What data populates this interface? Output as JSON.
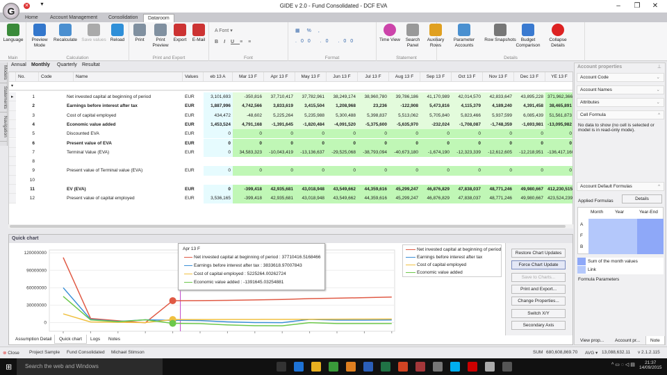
{
  "app": {
    "title": "GIDE v 2.0 - Fund Consolidated - DCF EVA",
    "logo_letter": "G"
  },
  "ribbon_tabs": [
    "Home",
    "Account Management",
    "Consolidation",
    "Dataroom"
  ],
  "ribbon": {
    "groups": [
      "Main",
      "Calculation",
      "Print and Export",
      "Font",
      "Format",
      "Statement",
      "Details"
    ],
    "buttons": [
      {
        "label": "Language",
        "color": "#3a8a3a"
      },
      {
        "label": "Preview Mode",
        "color": "#3377cc"
      },
      {
        "label": "Recalculate",
        "color": "#4a8fd0"
      },
      {
        "label": "Save values",
        "color": "#aaaaaa"
      },
      {
        "label": "Reload",
        "color": "#2f8fd8"
      },
      {
        "label": "Print",
        "color": "#8090a0"
      },
      {
        "label": "Print Preview",
        "color": "#8090a0"
      },
      {
        "label": "Export",
        "color": "#cc3333"
      },
      {
        "label": "E-Mail",
        "color": "#cc3333"
      },
      {
        "label": "Time View",
        "color": "#cc44aa"
      },
      {
        "label": "Search Panel",
        "color": "#999999"
      },
      {
        "label": "Auxiliary Rows",
        "color": "#e0a020"
      },
      {
        "label": "Parameter Accounts",
        "color": "#4a90d0"
      },
      {
        "label": "Row Snapshots",
        "color": "#777777"
      },
      {
        "label": "Budget Comparison",
        "color": "#3a7ad0"
      },
      {
        "label": "Collapse Details",
        "color": "#dd2222"
      }
    ],
    "font_label": "Font"
  },
  "view_tabs": [
    "Annual",
    "Monthly",
    "Quarterly",
    "Resultat"
  ],
  "side_tabs": [
    "Models",
    "Statements",
    "Navigation"
  ],
  "grid": {
    "headers": [
      "No.",
      "Code",
      "Name",
      "Values"
    ],
    "periods": [
      "eb 13 A",
      "Mar 13 F",
      "Apr 13 F",
      "May 13 F",
      "Jun 13 F",
      "Jul 13 F",
      "Aug 13 F",
      "Sep 13 F",
      "Oct 13 F",
      "Nov 13 F",
      "Dec 13 F",
      "YE 13 F"
    ],
    "rows": [
      {
        "no": "1",
        "name": "Net invested capital at beginning of period",
        "unit": "EUR",
        "bold": false,
        "v": [
          "3,101,693",
          "-350,816",
          "37,710,417",
          "37,782,961",
          "38,249,174",
          "38,960,780",
          "39,786,186",
          "41,170,989",
          "42,014,570",
          "42,833,647",
          "43,895,228",
          "371,962,366"
        ]
      },
      {
        "no": "2",
        "name": "Earnings before interest after tax",
        "unit": "EUR",
        "bold": true,
        "v": [
          "1,887,996",
          "4,742,566",
          "3,833,619",
          "3,415,504",
          "1,208,968",
          "23,236",
          "-122,908",
          "5,473,816",
          "4,115,379",
          "4,189,240",
          "4,391,458",
          "38,465,891"
        ]
      },
      {
        "no": "3",
        "name": "Cost of capital employed",
        "unit": "EUR",
        "bold": false,
        "v": [
          "434,472",
          "-48,602",
          "5,225,264",
          "5,235,988",
          "5,300,488",
          "5,398,837",
          "5,513,062",
          "5,705,840",
          "5,823,466",
          "5,937,599",
          "6,085,439",
          "51,561,873"
        ]
      },
      {
        "no": "4",
        "name": "Economic value added",
        "unit": "EUR",
        "bold": true,
        "v": [
          "1,453,524",
          "4,791,168",
          "-1,391,645",
          "-1,820,484",
          "-4,091,520",
          "-5,375,600",
          "-5,635,970",
          "-232,024",
          "-1,708,087",
          "-1,748,359",
          "-1,693,981",
          "-13,095,982"
        ]
      },
      {
        "no": "5",
        "name": "Discounted EVA",
        "unit": "EUR",
        "bold": false,
        "v": [
          "0",
          "0",
          "0",
          "0",
          "0",
          "0",
          "0",
          "0",
          "0",
          "0",
          "0",
          "0"
        ]
      },
      {
        "no": "6",
        "name": "Present value of EVA",
        "unit": "EUR",
        "bold": true,
        "v": [
          "0",
          "0",
          "0",
          "0",
          "0",
          "0",
          "0",
          "0",
          "0",
          "0",
          "0",
          "0"
        ]
      },
      {
        "no": "7",
        "name": "Terminal Value (EVA)",
        "unit": "EUR",
        "bold": false,
        "v": [
          "0",
          "34,583,323",
          "-10,043,419",
          "-13,136,637",
          "-29,525,068",
          "-38,793,094",
          "-40,673,180",
          "-1,674,190",
          "-12,323,339",
          "-12,612,605",
          "-12,218,951",
          "-136,417,160"
        ]
      },
      {
        "no": "8",
        "name": "",
        "unit": "",
        "bold": false,
        "v": []
      },
      {
        "no": "9",
        "name": "Present value of Terminal value (EVA)",
        "unit": "EUR",
        "bold": false,
        "v": [
          "0",
          "0",
          "0",
          "0",
          "0",
          "0",
          "0",
          "0",
          "0",
          "0",
          "0",
          "0"
        ]
      },
      {
        "no": "10",
        "name": "",
        "unit": "",
        "bold": false,
        "v": []
      },
      {
        "no": "11",
        "name": "EV (EVA)",
        "unit": "EUR",
        "bold": true,
        "v": [
          "0",
          "-399,418",
          "42,935,681",
          "43,018,948",
          "43,549,662",
          "44,359,616",
          "45,299,247",
          "46,876,829",
          "47,838,037",
          "48,771,246",
          "49,980,667",
          "412,230,515"
        ]
      },
      {
        "no": "12",
        "name": "Present value of capital employed",
        "unit": "EUR",
        "bold": false,
        "v": [
          "3,536,165",
          "-399,418",
          "42,935,681",
          "43,018,948",
          "43,549,662",
          "44,359,616",
          "45,299,247",
          "46,876,829",
          "47,838,037",
          "48,771,246",
          "49,980,667",
          "423,524,239"
        ]
      }
    ]
  },
  "quick_chart": {
    "title": "Quick chart",
    "tooltip": {
      "title": "Apr 13 F",
      "lines": [
        "Net invested capital at beginning of period : 37710416.5168466",
        "Earnings before interest after tax : 3833618.97007843",
        "Cost of capital employed : 5225264.00262724",
        "Economic value added : -1391645.03254881"
      ]
    },
    "buttons": [
      "Restore Chart Updates",
      "Force Chart Update",
      "Save to Charts...",
      "Print and Export...",
      "Change Properties...",
      "Switch X/Y",
      "Secondary Axis"
    ]
  },
  "chart_data": {
    "type": "line",
    "categories": [
      "2012 A",
      "Jan 13 A",
      "Feb 13 A",
      "Mar 13 F",
      "Apr 13 F",
      "May 13 F",
      "Jun 13 F",
      "Jul 13 F",
      "Aug 13 F",
      "Sep 13 F",
      "Oct 13 F",
      "Nov 13 F",
      "Dec 13 F"
    ],
    "yticks": [
      "0",
      "30000000",
      "60000000",
      "90000000",
      "120000000"
    ],
    "ylim": [
      -15000000,
      125000000
    ],
    "highlight_index": 4,
    "legend_position": "right",
    "series": [
      {
        "name": "Net invested capital at beginning of period",
        "color": "#e05a45",
        "values": [
          112000000,
          7000000,
          3101693,
          -350816,
          37710417,
          37782961,
          38249174,
          38960780,
          39786186,
          41170989,
          42014570,
          42833647,
          43895228
        ]
      },
      {
        "name": "Earnings before interest after tax",
        "color": "#3a8fd6",
        "values": [
          60000000,
          5500000,
          1887996,
          4742566,
          3833619,
          3415504,
          1208968,
          23236,
          -122908,
          5473816,
          4115379,
          4189240,
          4391458
        ]
      },
      {
        "name": "Cost of capital employed",
        "color": "#f0c040",
        "values": [
          15000000,
          1000000,
          434472,
          -48602,
          5225264,
          5235988,
          5300488,
          5398837,
          5513062,
          5705840,
          5823466,
          5937599,
          6085439
        ]
      },
      {
        "name": "Economic value added",
        "color": "#6cc84a",
        "values": [
          45000000,
          4500000,
          1453524,
          4791168,
          -1391645,
          -1820484,
          -4091520,
          -5375600,
          -5635970,
          -232024,
          -1708087,
          -1748359,
          -1693981
        ]
      }
    ]
  },
  "bottom_tabs": [
    "Assumption Detail",
    "Quick chart",
    "Logs",
    "Notes"
  ],
  "right_panel": {
    "title": "Account properties",
    "sections": [
      "Account Code",
      "Account Names",
      "Attributes",
      "Cell Formula"
    ],
    "no_data": "No data to show (no cell is selected or model is in read-only mode).",
    "default_formulas": "Account Default Formulas",
    "applied_formulas": "Applied Formulas",
    "details_button": "Details",
    "formula_cols": [
      "Month",
      "Year",
      "Year-End"
    ],
    "formula_rows": [
      "A",
      "F",
      "B"
    ],
    "legend": [
      "Sum of the month values",
      "Link"
    ],
    "formula_params": "Formula Parameters",
    "tabs": [
      "View prop...",
      "Account pr...",
      "Note"
    ]
  },
  "status": {
    "close": "Close",
    "project": "Project Sample",
    "fund": "Fund Consolidated",
    "user": "Michael Stimson",
    "sum_label": "SUM",
    "sum": "680,608,869.70",
    "avg_label": "AVG",
    "avg": "13,088,632.11",
    "version": "v 2.1.2.115"
  },
  "taskbar": {
    "search": "Search the web and Windows",
    "time": "21:37",
    "date": "14/09/2015"
  }
}
